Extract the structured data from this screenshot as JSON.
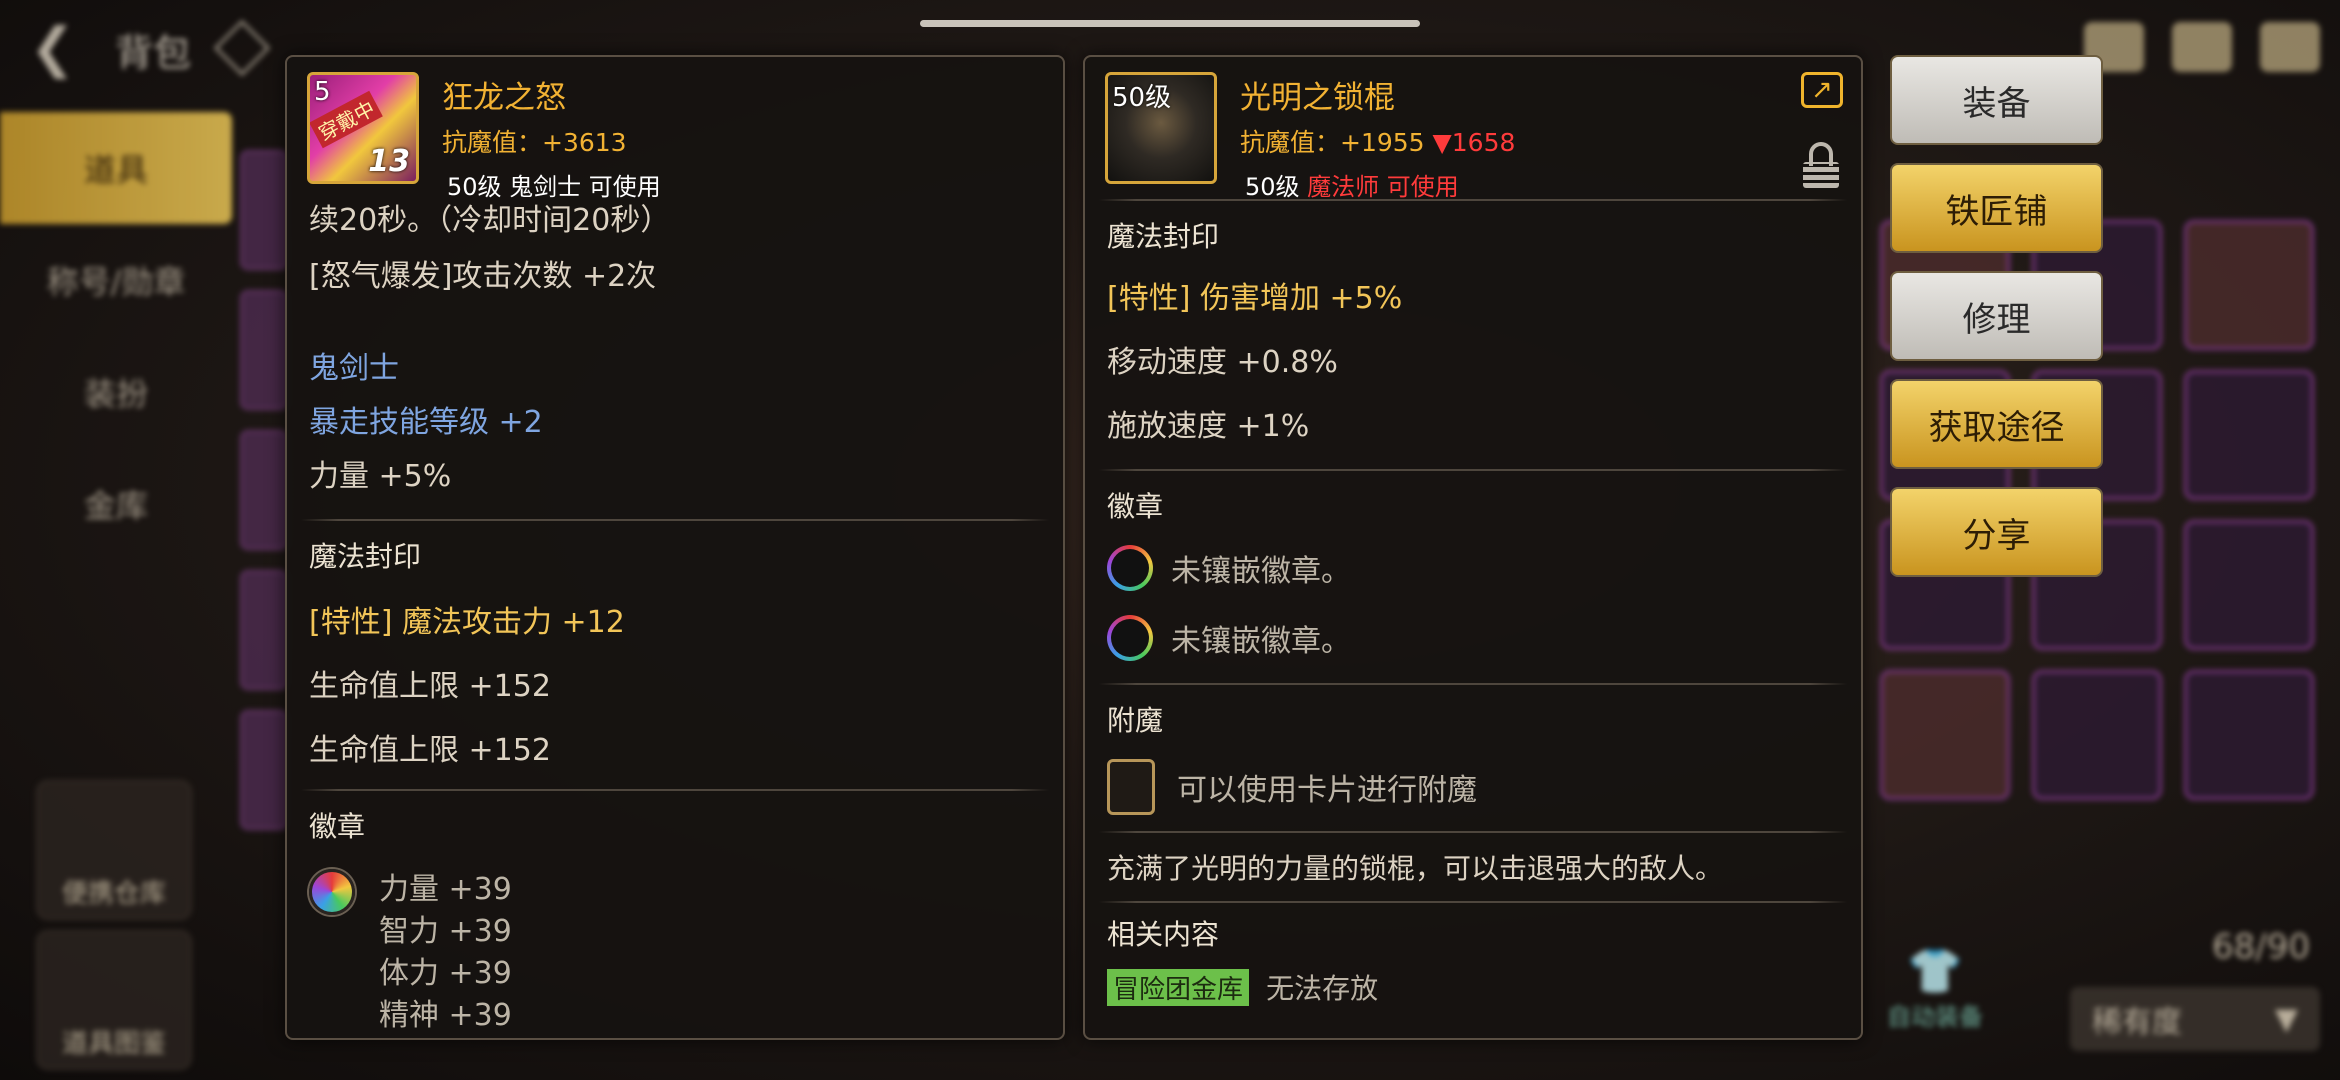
{
  "background": {
    "title": "背包",
    "menu": [
      "道具",
      "称号/勋章",
      "装扮",
      "金库"
    ],
    "tools": [
      "便携仓库",
      "道具图鉴"
    ],
    "bag_count": "68/90",
    "auto_equip_label": "自动装备",
    "sort_label": "稀有度"
  },
  "left_item": {
    "icon_level": "5",
    "icon_badge": "13",
    "icon_tag": "穿戴中",
    "name": "狂龙之怒",
    "stat": "抗魔值：+3613",
    "requirement": "50级 鬼剑士 可使用",
    "lines": {
      "duration": "续20秒。（冷却时间20秒）",
      "rage": "[怒气爆发]攻击次数 +2次",
      "class_name": "鬼剑士",
      "skill": "暴走技能等级 +2",
      "strength": "力量 +5%"
    },
    "seal_heading": "魔法封印",
    "seal_lines": [
      "[特性] 魔法攻击力 +12",
      "生命值上限 +152",
      "生命值上限 +152"
    ],
    "emblem_heading": "徽章",
    "emblem_lines": [
      "力量 +39",
      "智力 +39",
      "体力 +39",
      "精神 +39"
    ]
  },
  "right_item": {
    "icon_level": "50级",
    "name": "光明之锁棍",
    "stat_prefix": "抗魔值：+1955 ",
    "stat_down": "▼1658",
    "req_level": "50级 ",
    "req_class": "魔法师 可使用",
    "seal_heading": "魔法封印",
    "seal_lines": [
      "[特性] 伤害增加 +5%",
      "移动速度 +0.8%",
      "施放速度 +1%"
    ],
    "emblem_heading": "徽章",
    "emblem_slots": [
      "未镶嵌徽章。",
      "未镶嵌徽章。"
    ],
    "enchant_heading": "附魔",
    "enchant_text": "可以使用卡片进行附魔",
    "description": "充满了光明的力量的锁棍，可以击退强大的敌人。",
    "related_heading": "相关内容",
    "related_tag": "冒险团金库",
    "related_text": "无法存放"
  },
  "actions": {
    "equip": "装备",
    "blacksmith": "铁匠铺",
    "repair": "修理",
    "source": "获取途径",
    "share": "分享"
  },
  "colors": {
    "gold_text": "#f2b233",
    "down_red": "#ff3b3b",
    "class_blue": "#7fa5e0",
    "button_gold": "#e0b23b",
    "button_gray": "#d6d3ce"
  }
}
